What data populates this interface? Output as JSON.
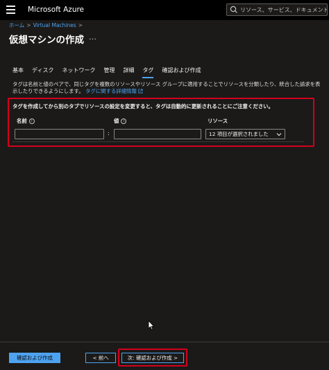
{
  "header": {
    "brand": "Microsoft Azure",
    "search_placeholder": "リソース、サービス、ドキュメントの検索 (G+/)"
  },
  "breadcrumb": {
    "home": "ホーム",
    "separator": ">",
    "item": "Virtual Machines",
    "trailing_separator": ">"
  },
  "page": {
    "title": "仮想マシンの作成",
    "more": "…"
  },
  "tabs": [
    {
      "label": "基本",
      "active": false
    },
    {
      "label": "ディスク",
      "active": false
    },
    {
      "label": "ネットワーク",
      "active": false
    },
    {
      "label": "管理",
      "active": false
    },
    {
      "label": "詳細",
      "active": false
    },
    {
      "label": "タグ",
      "active": true
    },
    {
      "label": "確認および作成",
      "active": false
    }
  ],
  "description": {
    "text": "タグは名前と値のペアで、同じタグを複数のリソースやリソース グループに適用することでリソースを分類したり、統合した請求を表示したりできるようにします。",
    "link": "タグに関する詳細情報"
  },
  "tags_section": {
    "notice": "タグを作成してから別のタブでリソースの設定を変更すると、タグは自動的に更新されることにご注意ください。",
    "col_name": "名前",
    "col_value": "値",
    "col_resource": "リソース",
    "info_glyph": "i",
    "name_value": "",
    "value_value": "",
    "colon": ":",
    "resource_selected": "12 項目が選択されました"
  },
  "footer": {
    "review_create": "確認および作成",
    "prev": "< 前へ",
    "next": "次: 確認および作成 >"
  },
  "colors": {
    "accent": "#4ea3f1",
    "highlight_box": "#d6001c",
    "background": "#1b1a19"
  }
}
